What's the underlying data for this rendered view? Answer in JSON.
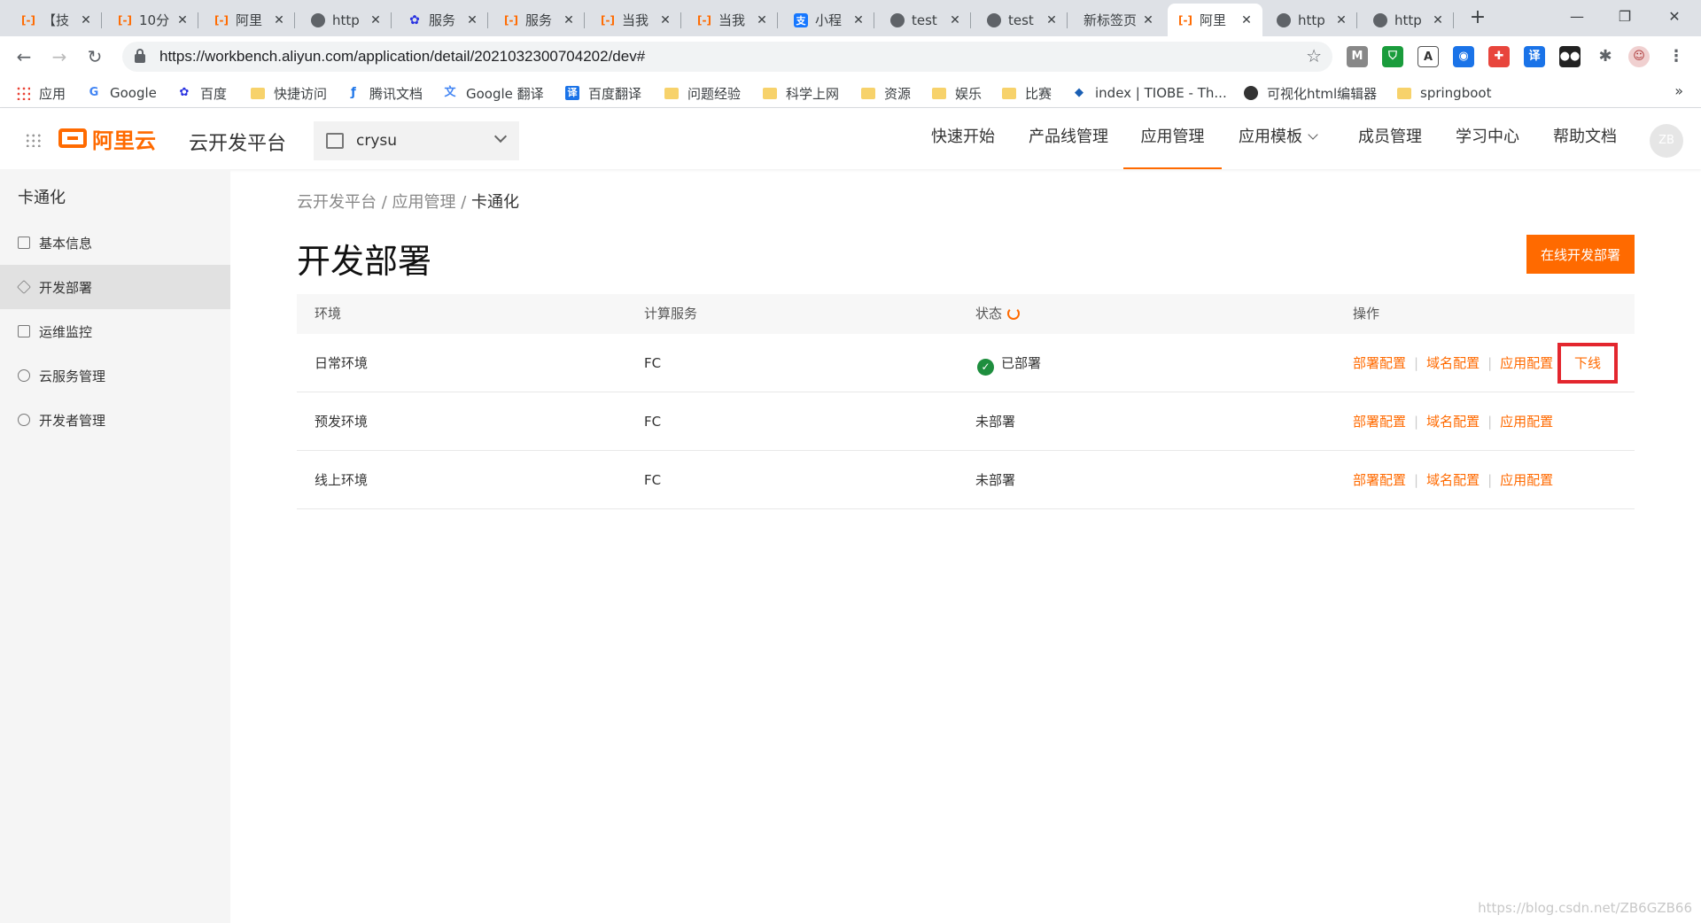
{
  "browser": {
    "tabs": [
      {
        "title": "【技",
        "icon": "aliyun-icon"
      },
      {
        "title": "10分",
        "icon": "aliyun-icon"
      },
      {
        "title": "阿里",
        "icon": "aliyun-icon"
      },
      {
        "title": "http",
        "icon": "globe-icon"
      },
      {
        "title": "服务",
        "icon": "baidu-paw-icon"
      },
      {
        "title": "服务",
        "icon": "aliyun-icon"
      },
      {
        "title": "当我",
        "icon": "aliyun-icon"
      },
      {
        "title": "当我",
        "icon": "aliyun-icon"
      },
      {
        "title": "小程",
        "icon": "alipay-icon"
      },
      {
        "title": "test",
        "icon": "globe-icon"
      },
      {
        "title": "test",
        "icon": "globe-icon"
      },
      {
        "title": "新标签页",
        "icon": ""
      },
      {
        "title": "阿里",
        "icon": "aliyun-icon",
        "active": true
      },
      {
        "title": "http",
        "icon": "globe-icon"
      },
      {
        "title": "http",
        "icon": "globe-icon"
      }
    ],
    "new_tab": "+",
    "url": "https://workbench.aliyun.com/application/detail/2021032300704202/dev#"
  },
  "bookmarks": [
    {
      "label": "应用",
      "icon": "apps-icon"
    },
    {
      "label": "Google",
      "icon": "google-icon"
    },
    {
      "label": "百度",
      "icon": "baidu-icon"
    },
    {
      "label": "快捷访问",
      "icon": "folder-icon"
    },
    {
      "label": "腾讯文档",
      "icon": "tencent-docs-icon"
    },
    {
      "label": "Google 翻译",
      "icon": "google-translate-icon"
    },
    {
      "label": "百度翻译",
      "icon": "baidu-translate-icon"
    },
    {
      "label": "问题经验",
      "icon": "folder-icon"
    },
    {
      "label": "科学上网",
      "icon": "folder-icon"
    },
    {
      "label": "资源",
      "icon": "folder-icon"
    },
    {
      "label": "娱乐",
      "icon": "folder-icon"
    },
    {
      "label": "比赛",
      "icon": "folder-icon"
    },
    {
      "label": "index | TIOBE - Th...",
      "icon": "tiobe-icon"
    },
    {
      "label": "可视化html编辑器",
      "icon": "globe-icon"
    },
    {
      "label": "springboot",
      "icon": "folder-icon"
    }
  ],
  "bookmarks_more": "»",
  "header": {
    "logo_text": "阿里云",
    "platform": "云开发平台",
    "project": "crysu",
    "nav": [
      "快速开始",
      "产品线管理",
      "应用管理",
      "应用模板",
      "成员管理",
      "学习中心",
      "帮助文档"
    ],
    "active_nav": "应用管理",
    "avatar": "ZB"
  },
  "sidebar": {
    "title": "卡通化",
    "items": [
      {
        "label": "基本信息",
        "icon": "document-icon"
      },
      {
        "label": "开发部署",
        "icon": "cube-icon",
        "active": true
      },
      {
        "label": "运维监控",
        "icon": "monitor-icon"
      },
      {
        "label": "云服务管理",
        "icon": "cloud-icon"
      },
      {
        "label": "开发者管理",
        "icon": "user-icon"
      }
    ]
  },
  "breadcrumb": {
    "items": [
      "云开发平台",
      "应用管理"
    ],
    "current": "卡通化",
    "separator": " / "
  },
  "page": {
    "title": "开发部署",
    "primary_button": "在线开发部署"
  },
  "table": {
    "columns": [
      "环境",
      "计算服务",
      "状态",
      "操作"
    ],
    "rows": [
      {
        "env": "日常环境",
        "service": "FC",
        "status": "已部署",
        "deployed": true,
        "actions": [
          "部署配置",
          "域名配置",
          "应用配置"
        ],
        "offline": "下线"
      },
      {
        "env": "预发环境",
        "service": "FC",
        "status": "未部署",
        "deployed": false,
        "actions": [
          "部署配置",
          "域名配置",
          "应用配置"
        ]
      },
      {
        "env": "线上环境",
        "service": "FC",
        "status": "未部署",
        "deployed": false,
        "actions": [
          "部署配置",
          "域名配置",
          "应用配置"
        ]
      }
    ]
  },
  "watermark": "https://blog.csdn.net/ZB6GZB66",
  "colors": {
    "accent": "#ff6a00",
    "highlight_box": "#e3262e",
    "success": "#1e8e3e"
  }
}
